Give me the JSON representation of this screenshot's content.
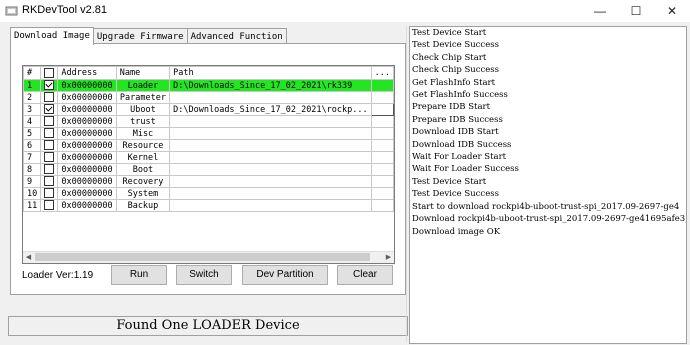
{
  "window": {
    "title": "RKDevTool v2.81",
    "minimize": "—",
    "maximize": "☐",
    "close": "✕"
  },
  "tabs": [
    {
      "label": "Download Image"
    },
    {
      "label": "Upgrade Firmware"
    },
    {
      "label": "Advanced Function"
    }
  ],
  "table": {
    "columns": [
      "#",
      "",
      "Address",
      "Name",
      "Path",
      "..."
    ],
    "rows": [
      {
        "num": "1",
        "checked": true,
        "address": "0x00000000",
        "name": "Loader",
        "path": "D:\\Downloads_Since_17_02_2021\\rk339",
        "selected": true
      },
      {
        "num": "2",
        "checked": false,
        "address": "0x00000000",
        "name": "Parameter",
        "path": "",
        "selected": false
      },
      {
        "num": "3",
        "checked": true,
        "address": "0x00000000",
        "name": "Uboot",
        "path": "D:\\Downloads_Since_17_02_2021\\rockp...",
        "selected": false
      },
      {
        "num": "4",
        "checked": false,
        "address": "0x00000000",
        "name": "trust",
        "path": "",
        "selected": false
      },
      {
        "num": "5",
        "checked": false,
        "address": "0x00000000",
        "name": "Misc",
        "path": "",
        "selected": false
      },
      {
        "num": "6",
        "checked": false,
        "address": "0x00000000",
        "name": "Resource",
        "path": "",
        "selected": false
      },
      {
        "num": "7",
        "checked": false,
        "address": "0x00000000",
        "name": "Kernel",
        "path": "",
        "selected": false
      },
      {
        "num": "8",
        "checked": false,
        "address": "0x00000000",
        "name": "Boot",
        "path": "",
        "selected": false
      },
      {
        "num": "9",
        "checked": false,
        "address": "0x00000000",
        "name": "Recovery",
        "path": "",
        "selected": false
      },
      {
        "num": "10",
        "checked": false,
        "address": "0x00000000",
        "name": "System",
        "path": "",
        "selected": false
      },
      {
        "num": "11",
        "checked": false,
        "address": "0x00000000",
        "name": "Backup",
        "path": "",
        "selected": false
      }
    ]
  },
  "loader_version": "Loader Ver:1.19",
  "buttons": {
    "run": "Run",
    "switch": "Switch",
    "dev_partition": "Dev Partition",
    "clear": "Clear"
  },
  "status": "Found One LOADER Device",
  "log": [
    "Test Device Start",
    "Test Device Success",
    "Check Chip Start",
    " Check Chip Success",
    "Get FlashInfo Start",
    "Get FlashInfo Success",
    "Prepare IDB Start",
    "Prepare IDB Success",
    "Download IDB Start",
    "Download IDB Success",
    "Wait For Loader Start",
    "Wait For Loader Success",
    "Test Device Start",
    "Test Device Success",
    "Start to download rockpi4b-uboot-trust-spi_2017.09-2697-ge4",
    "Download rockpi4b-uboot-trust-spi_2017.09-2697-ge41695afe3_",
    "Download image OK"
  ],
  "colors": {
    "selected_row": "#22e622",
    "window_bg": "#f0f0f0"
  }
}
